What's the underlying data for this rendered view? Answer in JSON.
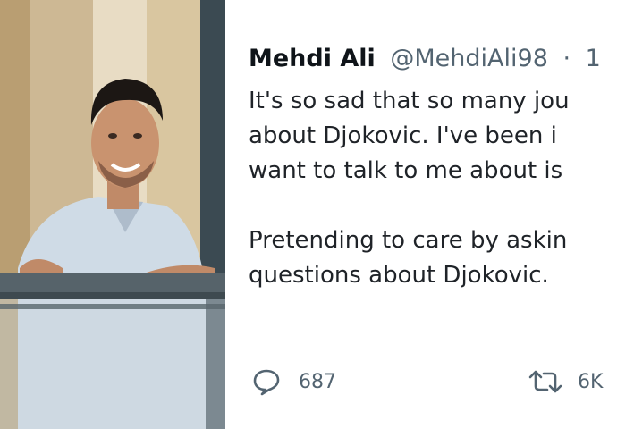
{
  "tweet": {
    "author_name": "Mehdi Ali",
    "author_handle": "@MehdiAli98",
    "separator": "·",
    "time": "1",
    "lines": [
      "It's so sad that so many jou",
      "about Djokovic. I've been i",
      "want to talk to me about is"
    ],
    "lines2": [
      "Pretending to care by askin",
      "questions about Djokovic."
    ],
    "actions": {
      "reply_icon": "reply-icon",
      "reply_count": "687",
      "retweet_icon": "retweet-icon",
      "retweet_count": "6K"
    }
  },
  "photo": {
    "subject": "man on balcony"
  },
  "colors": {
    "text": "#1f2328",
    "secondary": "#536471"
  }
}
